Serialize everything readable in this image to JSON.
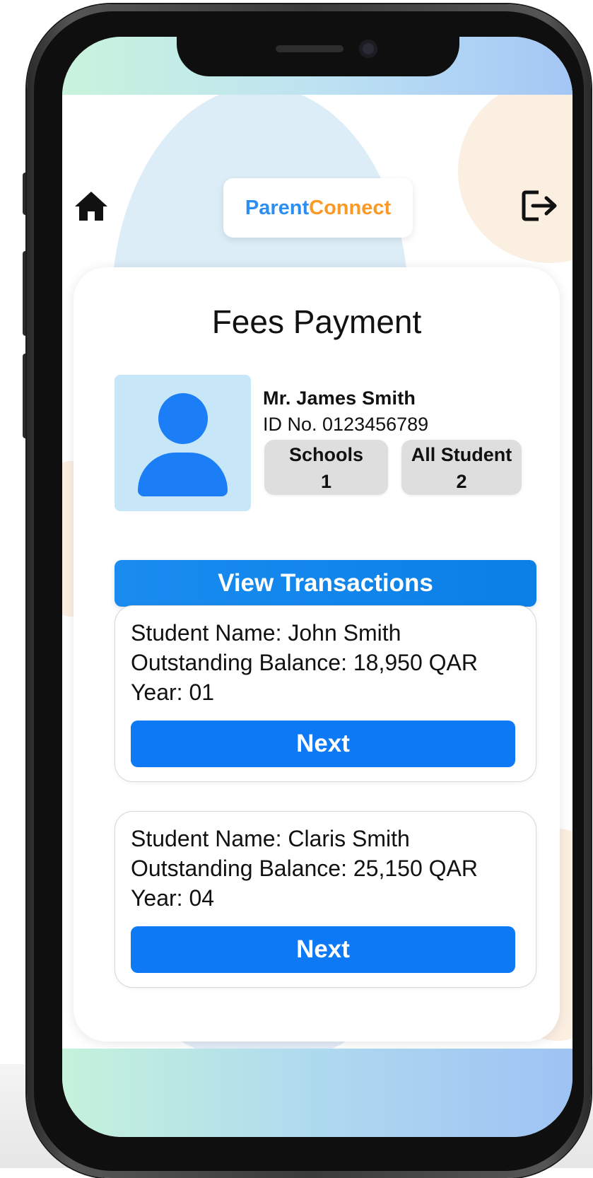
{
  "header": {
    "logo_part1": "Parent",
    "logo_part2": "Connect",
    "home_icon": "home-icon",
    "logout_icon": "logout-icon"
  },
  "page": {
    "title": "Fees Payment"
  },
  "profile": {
    "name": "Mr. James Smith",
    "id_text": "ID No. 0123456789",
    "stats": [
      {
        "label": "Schools",
        "value": "1"
      },
      {
        "label": "All Student",
        "value": "2"
      }
    ]
  },
  "actions": {
    "view_transactions": "View Transactions"
  },
  "students": [
    {
      "name_line": "Student Name: John Smith",
      "balance_line": "Outstanding Balance: 18,950 QAR",
      "year_line": "Year: 01",
      "button": "Next"
    },
    {
      "name_line": "Student Name: Claris Smith",
      "balance_line": "Outstanding Balance: 25,150 QAR",
      "year_line": "Year: 04",
      "button": "Next"
    }
  ],
  "colors": {
    "primary": "#0d79f5",
    "logo_blue": "#2b8ef0",
    "logo_orange": "#f99a26",
    "avatar_bg": "#c7e6f8"
  }
}
